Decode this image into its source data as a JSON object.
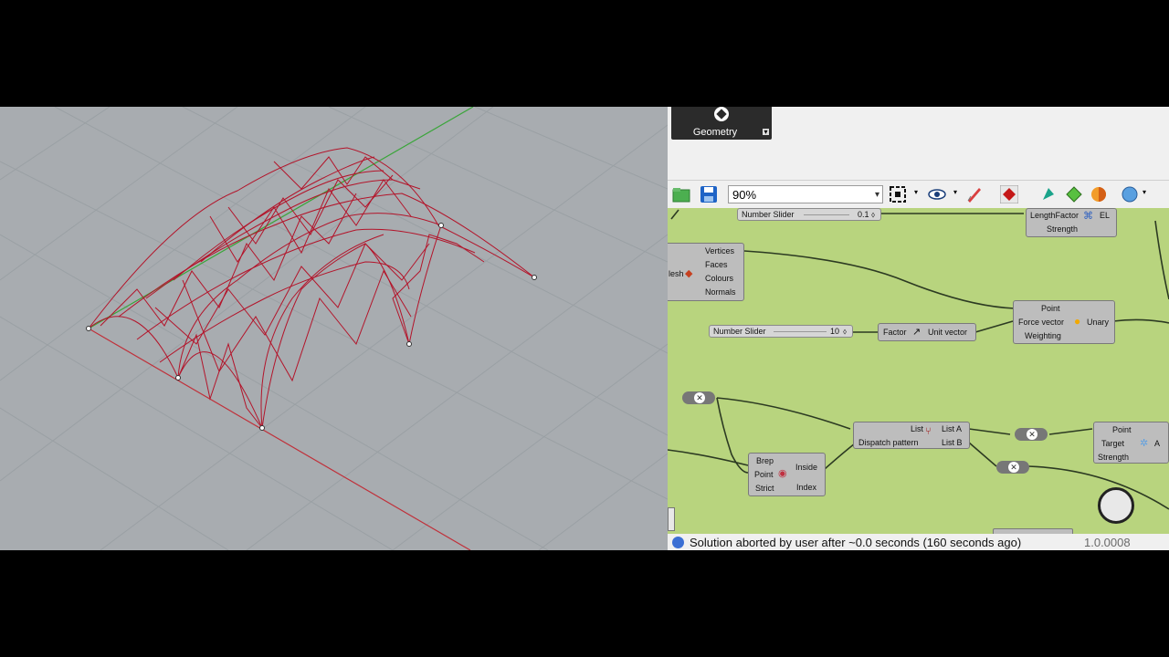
{
  "viewport": {
    "name": "rhino-perspective-viewport"
  },
  "grasshopper": {
    "geometry_tab": {
      "label": "Geometry"
    },
    "toolbar": {
      "zoom_value": "90%"
    },
    "components": {
      "slider_top": {
        "label": "Number Slider",
        "value": "0.1"
      },
      "length_comp": {
        "input1": "LengthFactor",
        "input2": "Strength",
        "output": "EL"
      },
      "mesh_comp": {
        "prefix": "lesh",
        "out1": "Vertices",
        "out2": "Faces",
        "out3": "Colours",
        "out4": "Normals"
      },
      "unary_comp": {
        "in1": "Point",
        "in2": "Force vector",
        "in3": "Weighting",
        "out": "Unary"
      },
      "slider_mid": {
        "label": "Number Slider",
        "value": "10"
      },
      "unit_comp": {
        "in": "Factor",
        "out": "Unit vector"
      },
      "dispatch_comp": {
        "in1": "List",
        "in2": "Dispatch pattern",
        "out1": "List A",
        "out2": "List B"
      },
      "anchor_comp": {
        "in1": "Point",
        "in2": "Target",
        "in3": "Strength",
        "out": "A"
      },
      "inside_comp": {
        "in1": "Brep",
        "in2": "Point",
        "in3": "Strict",
        "out1": "Inside",
        "out2": "Index"
      }
    },
    "status": {
      "message": "Solution aborted by user after ~0.0 seconds (160 seconds ago)",
      "version": "1.0.0008"
    }
  }
}
